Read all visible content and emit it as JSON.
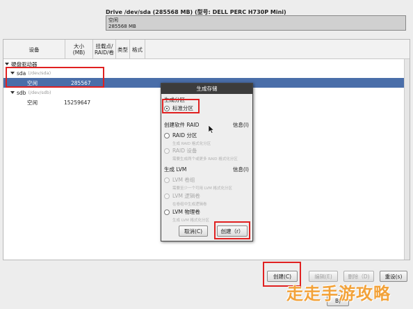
{
  "drive": {
    "title": "Drive /dev/sda (285568 MB) (型号: DELL PERC H730P Mini)",
    "box_line1": "空闲",
    "box_line2": "285568 MB"
  },
  "table": {
    "headers": {
      "device": "设备",
      "size": "大小\n(MB)",
      "mount": "挂载点/\nRAID/卷",
      "type": "类型",
      "format": "格式"
    },
    "group_label": "硬盘驱动器",
    "disks": [
      {
        "name": "sda",
        "path": "(/dev/sda)",
        "free_label": "空闲",
        "free_size": "285567"
      },
      {
        "name": "sdb",
        "path": "(/dev/sdb)",
        "free_label": "空闲",
        "free_size": "15259647"
      }
    ]
  },
  "buttons": {
    "create": "创建(C)",
    "edit": "编辑(E)",
    "delete": "删除（D)",
    "reset": "重设(s)",
    "back_partial": "B)"
  },
  "dialog": {
    "title": "生成存储",
    "section_partition": "生成分区",
    "option_standard": "标准分区",
    "section_raid": "创建软件 RAID",
    "info_raid": "信息(I)",
    "option_raid_partition": "RAID 分区",
    "sub_raid_partition": "生成 RAID 格式化分区",
    "option_raid_device": "RAID 设备",
    "sub_raid_device": "需要生成两个或更多 RAID 格式化分区",
    "section_lvm": "生成 LVM",
    "info_lvm": "信息(I)",
    "option_lvm_vg": "LVM 卷组",
    "sub_lvm_vg": "需要至少一个可用 LVM 格式化分区",
    "option_lvm_lv": "LVM 逻辑卷",
    "sub_lvm_lv": "在卷组中生成逻辑卷",
    "option_lvm_pv": "LVM 物理卷",
    "sub_lvm_pv": "生成 LVM 格式化分区",
    "cancel": "取消(C)",
    "create": "创建（r）"
  },
  "watermark": "走走手游攻略",
  "colors": {
    "selection": "#4a6ea9",
    "highlight": "#e02020",
    "dialog_title": "#3c3c3c"
  }
}
